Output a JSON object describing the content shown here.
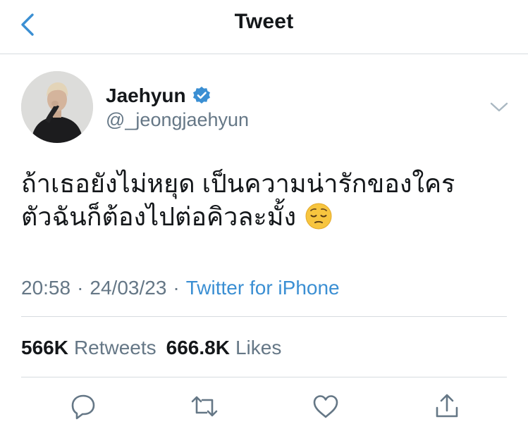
{
  "nav": {
    "title": "Tweet",
    "back_icon": "chevron-left-icon"
  },
  "author": {
    "display_name": "Jaehyun",
    "handle": "@_jeongjaehyun",
    "verified": true,
    "verified_color": "#3b8fd3"
  },
  "tweet": {
    "lines": [
      "ถ้าเธอยังไม่หยุด เป็นความน่ารักของใคร",
      "ตัวฉันก็ต้องไปต่อคิวละมั้ง"
    ],
    "emoji": "pensive-face-icon",
    "time": "20:58",
    "separator": "·",
    "date": "24/03/23",
    "source": "Twitter for iPhone"
  },
  "stats": {
    "retweets_count": "566K",
    "retweets_label": "Retweets",
    "likes_count": "666.8K",
    "likes_label": "Likes"
  },
  "colors": {
    "accent": "#3b8fd3",
    "text_primary": "#14171a",
    "text_secondary": "#657786",
    "divider": "#d7dbdf"
  }
}
